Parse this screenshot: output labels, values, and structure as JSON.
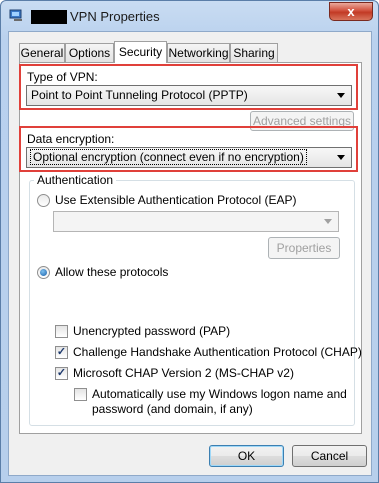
{
  "window": {
    "title": "VPN Properties",
    "close_glyph": "x",
    "accent_close": "#c23a25"
  },
  "tabs": [
    {
      "label": "General"
    },
    {
      "label": "Options"
    },
    {
      "label": "Security"
    },
    {
      "label": "Networking"
    },
    {
      "label": "Sharing"
    }
  ],
  "active_tab": "Security",
  "vpn_type": {
    "label": "Type of VPN:",
    "value": "Point to Point Tunneling Protocol (PPTP)"
  },
  "advanced_settings": {
    "label": "Advanced settings"
  },
  "encryption": {
    "label": "Data encryption:",
    "value": "Optional encryption (connect even if no encryption)"
  },
  "authentication": {
    "group_label": "Authentication",
    "eap_label": "Use Extensible Authentication Protocol (EAP)",
    "eap_selected": false,
    "eap_combo_value": "",
    "properties_label": "Properties",
    "allow_label": "Allow these protocols",
    "allow_selected": true,
    "protocols": [
      {
        "label": "Unencrypted password (PAP)",
        "checked": false
      },
      {
        "label": "Challenge Handshake Authentication Protocol (CHAP)",
        "checked": true
      },
      {
        "label": "Microsoft CHAP Version 2 (MS-CHAP v2)",
        "checked": true
      }
    ],
    "autologon_label_line1": "Automatically use my Windows logon name and",
    "autologon_label_line2": "password (and domain, if any)",
    "autologon_checked": false
  },
  "footer": {
    "ok_label": "OK",
    "cancel_label": "Cancel"
  },
  "highlight_color": "#e0403a"
}
